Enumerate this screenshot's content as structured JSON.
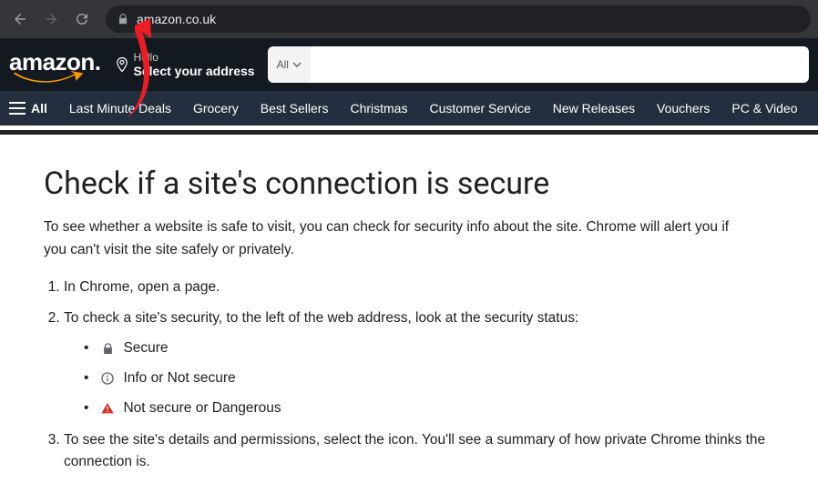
{
  "browser": {
    "url": "amazon.co.uk"
  },
  "amazon": {
    "logo_text": "amazon.",
    "deliver_hello": "Hello",
    "deliver_addr": "Select your address",
    "search_cat": "All",
    "nav": [
      "All",
      "Last Minute Deals",
      "Grocery",
      "Best Sellers",
      "Christmas",
      "Customer Service",
      "New Releases",
      "Vouchers",
      "PC & Video"
    ]
  },
  "article": {
    "heading": "Check if a site's connection is secure",
    "lead": "To see whether a website is safe to visit, you can check for security info about the site. Chrome will alert you if you can't visit the site safely or privately.",
    "step1": "In Chrome, open a page.",
    "step2": "To check a site's security, to the left of the web address, look at the security status:",
    "status_secure": "Secure",
    "status_info": "Info or Not secure",
    "status_danger": "Not secure or Dangerous",
    "step3": "To see the site's details and permissions, select the icon. You'll see a summary of how private Chrome thinks the connection is."
  }
}
